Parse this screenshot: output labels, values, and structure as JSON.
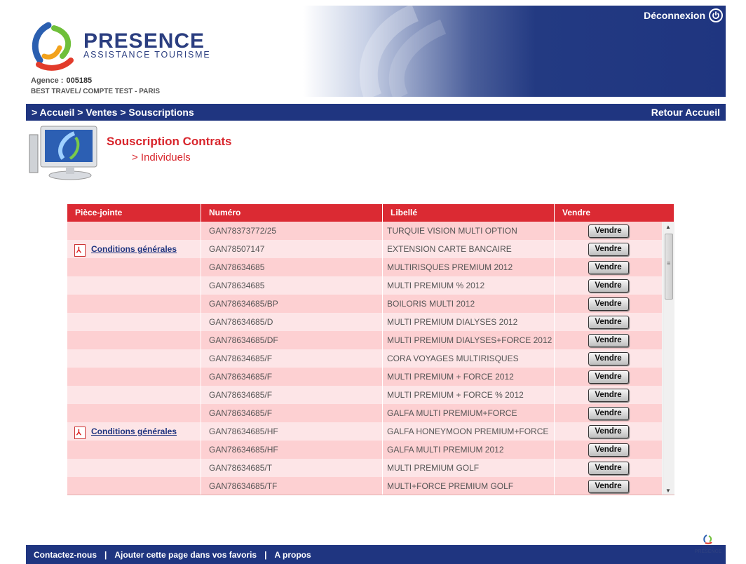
{
  "header": {
    "brand": "PRESENCE",
    "brand_sub": "ASSISTANCE TOURISME",
    "agence_label": "Agence :",
    "agence_code": "005185",
    "agence_name": "BEST TRAVEL/ COMPTE TEST - PARIS",
    "logout_label": "Déconnexion"
  },
  "nav": {
    "crumbs": [
      "> Accueil",
      "> Ventes",
      "> Souscriptions"
    ],
    "back_label": "Retour Accueil"
  },
  "page": {
    "title": "Souscription Contrats",
    "subtitle": "> Individuels"
  },
  "table": {
    "headers": [
      "Pièce-jointe",
      "Numéro",
      "Libellé",
      "Vendre"
    ],
    "button_label": "Vendre",
    "rows": [
      {
        "attachment": "",
        "numero": "GAN78373772/25",
        "libelle": "TURQUIE VISION MULTI OPTION"
      },
      {
        "attachment": "Conditions générales",
        "numero": "GAN78507147",
        "libelle": "EXTENSION CARTE BANCAIRE"
      },
      {
        "attachment": "",
        "numero": "GAN78634685",
        "libelle": "MULTIRISQUES PREMIUM 2012"
      },
      {
        "attachment": "",
        "numero": "GAN78634685",
        "libelle": "MULTI PREMIUM % 2012"
      },
      {
        "attachment": "",
        "numero": "GAN78634685/BP",
        "libelle": "BOILORIS MULTI 2012"
      },
      {
        "attachment": "",
        "numero": "GAN78634685/D",
        "libelle": "MULTI PREMIUM DIALYSES 2012"
      },
      {
        "attachment": "",
        "numero": "GAN78634685/DF",
        "libelle": "MULTI PREMIUM DIALYSES+FORCE 2012"
      },
      {
        "attachment": "",
        "numero": "GAN78634685/F",
        "libelle": "CORA VOYAGES MULTIRISQUES"
      },
      {
        "attachment": "",
        "numero": "GAN78634685/F",
        "libelle": "MULTI PREMIUM + FORCE 2012"
      },
      {
        "attachment": "",
        "numero": "GAN78634685/F",
        "libelle": "MULTI PREMIUM + FORCE % 2012"
      },
      {
        "attachment": "",
        "numero": "GAN78634685/F",
        "libelle": "GALFA MULTI PREMIUM+FORCE"
      },
      {
        "attachment": "Conditions générales",
        "numero": "GAN78634685/HF",
        "libelle": "GALFA HONEYMOON PREMIUM+FORCE"
      },
      {
        "attachment": "",
        "numero": "GAN78634685/HF",
        "libelle": "GALFA MULTI PREMIUM 2012"
      },
      {
        "attachment": "",
        "numero": "GAN78634685/T",
        "libelle": "MULTI PREMIUM GOLF"
      },
      {
        "attachment": "",
        "numero": "GAN78634685/TF",
        "libelle": "MULTI+FORCE PREMIUM GOLF"
      }
    ]
  },
  "footer": {
    "links": [
      "Contactez-nous",
      "Ajouter cette page dans vos favoris",
      "A propos"
    ],
    "separator": "|",
    "group_small": "GROUPE",
    "group_brand": "PRESENCE"
  },
  "colors": {
    "navy": "#1f3580",
    "red": "#db2a33",
    "row_odd": "#fdd0d2",
    "row_even": "#fde5e7"
  },
  "icons": [
    "presence-logo",
    "power-icon",
    "monitor-icon",
    "pdf-icon",
    "scroll-up-icon",
    "scroll-down-icon"
  ]
}
